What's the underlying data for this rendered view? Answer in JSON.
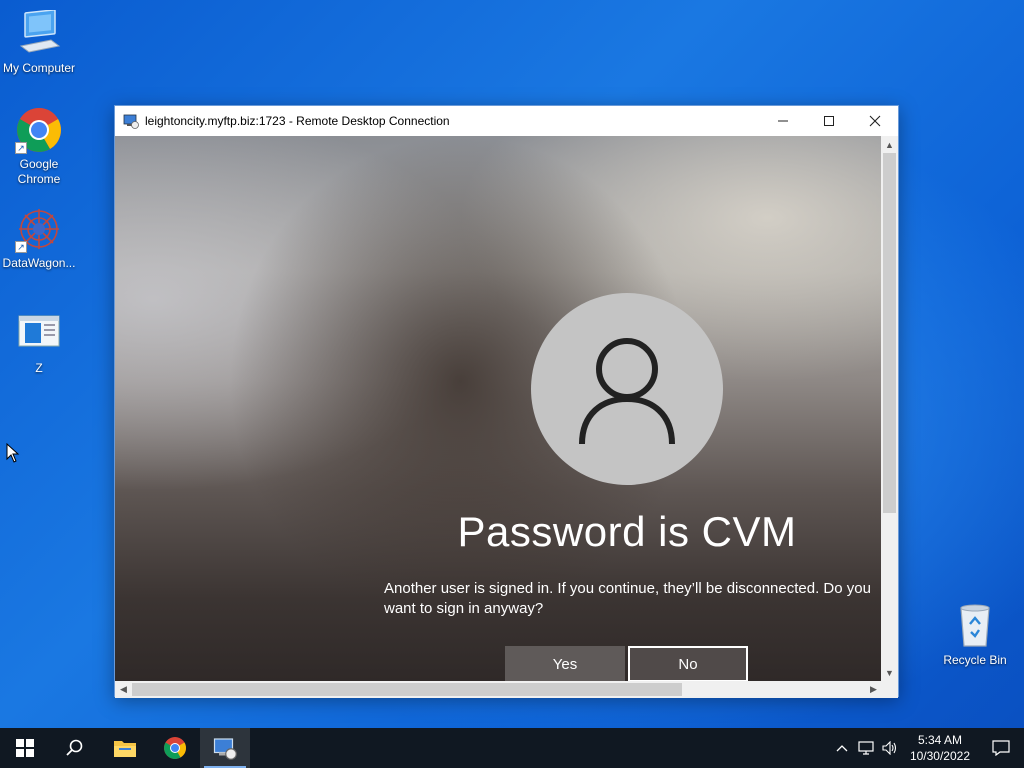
{
  "desktop": {
    "icons": [
      {
        "label": "My Computer"
      },
      {
        "label": "Google\nChrome"
      },
      {
        "label": "DataWagon..."
      },
      {
        "label": "Z"
      },
      {
        "label": "Recycle Bin"
      }
    ]
  },
  "rdp_window": {
    "title": "leightoncity.myftp.biz:1723 - Remote Desktop Connection",
    "controls": {
      "minimize": "—",
      "maximize": "☐",
      "close": "✕"
    },
    "login": {
      "username": "Password is CVM",
      "message": "Another user is signed in. If you continue, they’ll be disconnected. Do you want to sign in anyway?",
      "yes_label": "Yes",
      "no_label": "No"
    }
  },
  "taskbar": {
    "apps": [
      "start-icon",
      "search-icon",
      "file-explorer-icon",
      "chrome-icon",
      "remote-desktop-icon"
    ],
    "active_app": "remote-desktop-icon",
    "time": "5:34 AM",
    "date": "10/30/2022"
  },
  "colors": {
    "desktop_blue": "#1a78e2",
    "taskbar": "#101822"
  }
}
